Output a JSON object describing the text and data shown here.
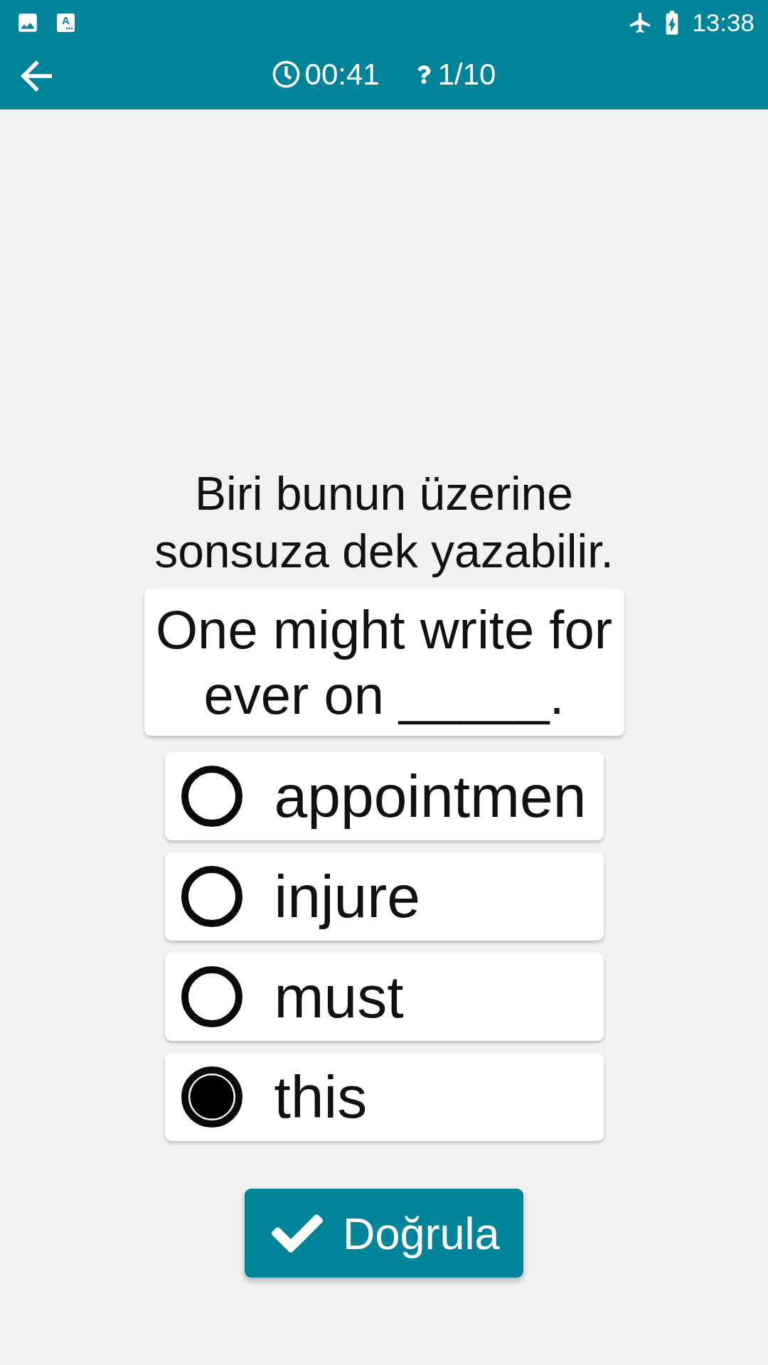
{
  "status_bar": {
    "notification_letter": "A",
    "time": "13:38"
  },
  "toolbar": {
    "timer": "00:41",
    "progress": "1/10"
  },
  "question": {
    "prompt": "Biri bunun üzerine sonsuza dek yazabilir.",
    "sentence": "One might write for ever on _____."
  },
  "options": [
    {
      "label": "appointmen",
      "selected": false
    },
    {
      "label": "injure",
      "selected": false
    },
    {
      "label": "must",
      "selected": false
    },
    {
      "label": "this",
      "selected": true
    }
  ],
  "verify_button": {
    "label": "Doğrula"
  }
}
